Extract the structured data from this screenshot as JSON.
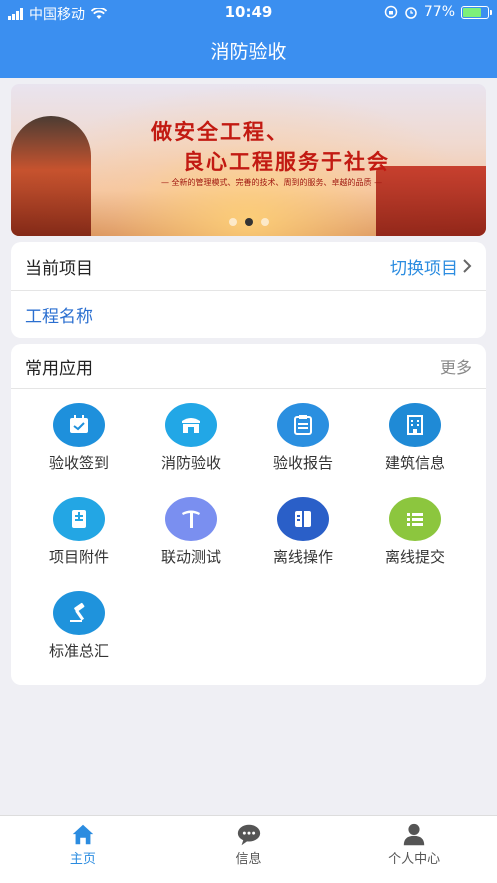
{
  "status_bar": {
    "carrier": "中国移动",
    "time": "10:49",
    "battery": "77%",
    "battery_level": 0.77
  },
  "nav": {
    "title": "消防验收"
  },
  "banner": {
    "headline_1": "做安全工程、",
    "headline_2": "良心工程服务于社会",
    "tagline": "— 全新的管理模式、完善的技术、周到的服务、卓越的品质 —",
    "slide_count": 3,
    "active_slide": 2
  },
  "project": {
    "current_label": "当前项目",
    "switch_label": "切换项目",
    "name": "工程名称"
  },
  "apps": {
    "header": "常用应用",
    "more": "更多",
    "items": [
      {
        "label": "验收签到",
        "icon": "calendar-check-icon",
        "color": "#1e90dc"
      },
      {
        "label": "消防验收",
        "icon": "store-icon",
        "color": "#22a7e6"
      },
      {
        "label": "验收报告",
        "icon": "clipboard-icon",
        "color": "#2a8fe0"
      },
      {
        "label": "建筑信息",
        "icon": "building-icon",
        "color": "#1f8ad6"
      },
      {
        "label": "项目附件",
        "icon": "document-icon",
        "color": "#23a6e4"
      },
      {
        "label": "联动测试",
        "icon": "pickaxe-icon",
        "color": "#7a8ff0"
      },
      {
        "label": "离线操作",
        "icon": "book-icon",
        "color": "#2a5fc8"
      },
      {
        "label": "离线提交",
        "icon": "list-icon",
        "color": "#8cc63e"
      },
      {
        "label": "标准总汇",
        "icon": "gavel-icon",
        "color": "#1f93dc"
      }
    ]
  },
  "tabs": [
    {
      "label": "主页",
      "icon": "home-icon",
      "active": true
    },
    {
      "label": "信息",
      "icon": "chat-icon",
      "active": false
    },
    {
      "label": "个人中心",
      "icon": "user-icon",
      "active": false
    }
  ]
}
